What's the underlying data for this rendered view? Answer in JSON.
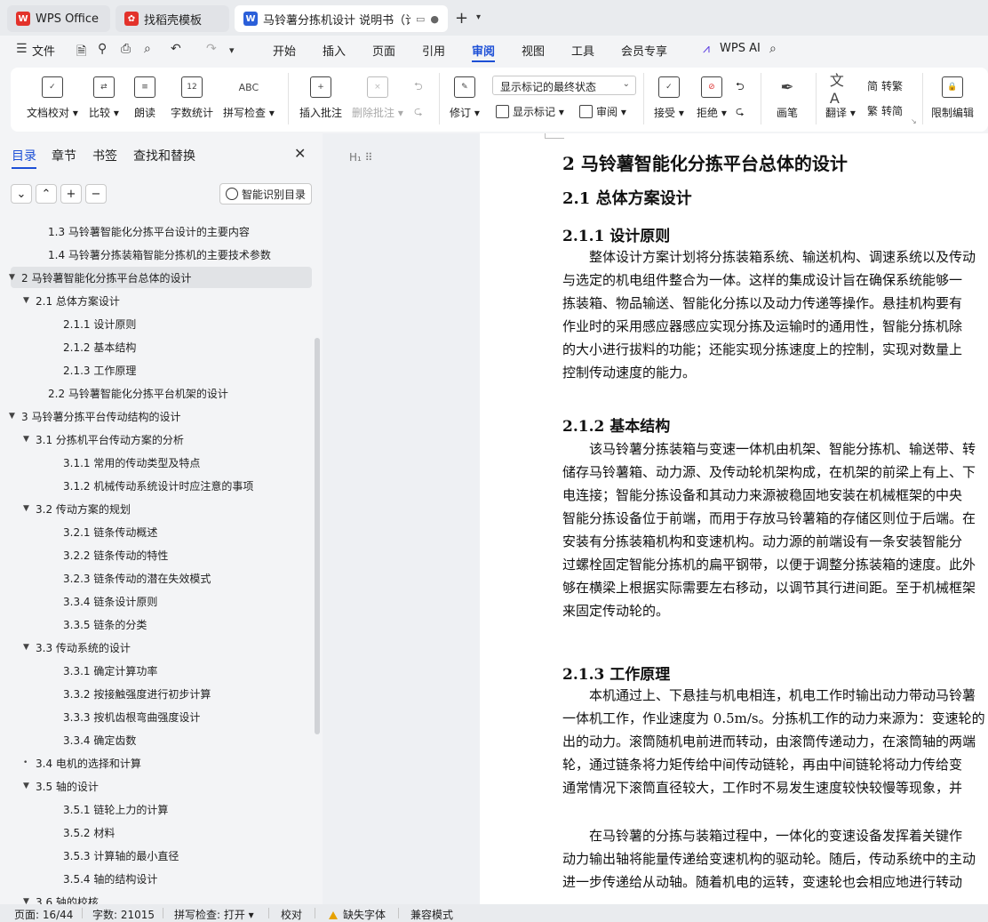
{
  "tabs": [
    {
      "label": "WPS Office",
      "icon": "wps-logo-icon",
      "color": "#e3322b"
    },
    {
      "label": "找稻壳模板",
      "icon": "docer-logo-icon",
      "color": "#e3322b"
    },
    {
      "label": "马铃薯分拣机设计 说明书（论",
      "icon": "writer-logo-icon",
      "color": "#2b5fd9"
    }
  ],
  "menu": {
    "file": "文件",
    "items": [
      "开始",
      "插入",
      "页面",
      "引用",
      "审阅",
      "视图",
      "工具",
      "会员专享"
    ],
    "active": "审阅",
    "ai": "WPS AI"
  },
  "ribbon": {
    "doc_check": "文档校对",
    "compare": "比较",
    "read": "朗读",
    "word_count": "字数统计",
    "spell_check": "拼写检查",
    "abc": "ABC",
    "insert_comment": "插入批注",
    "delete_comment": "删除批注",
    "revise": "修订",
    "markup_mode": "显示标记的最终状态",
    "show_markup": "显示标记",
    "review": "审阅",
    "accept": "接受",
    "reject": "拒绝",
    "ink": "画笔",
    "translate": "翻译",
    "to_traditional": "转繁",
    "to_simplified": "转简",
    "restrict": "限制编辑"
  },
  "sidebar": {
    "tabs": [
      "目录",
      "章节",
      "书签",
      "查找和替换"
    ],
    "smart_toc": "智能识别目录",
    "toc": [
      {
        "text": "1.3  马铃薯智能化分拣平台设计的主要内容",
        "level": 2,
        "caret": ""
      },
      {
        "text": "1.4  马铃薯分拣装箱智能分拣机的主要技术参数",
        "level": 2,
        "caret": ""
      },
      {
        "text": "2  马铃薯智能化分拣平台总体的设计",
        "level": 1,
        "caret": "▼",
        "selected": true
      },
      {
        "text": "2.1  总体方案设计",
        "level": 2,
        "caret": "▼"
      },
      {
        "text": "2.1.1  设计原则",
        "level": 3,
        "caret": ""
      },
      {
        "text": "2.1.2  基本结构",
        "level": 3,
        "caret": ""
      },
      {
        "text": "2.1.3  工作原理",
        "level": 3,
        "caret": ""
      },
      {
        "text": "2.2 马铃薯智能化分拣平台机架的设计",
        "level": 2,
        "caret": ""
      },
      {
        "text": "3  马铃薯分拣平台传动结构的设计",
        "level": 1,
        "caret": "▼"
      },
      {
        "text": "3.1 分拣机平台传动方案的分析",
        "level": 2,
        "caret": "▼"
      },
      {
        "text": "3.1.1 常用的传动类型及特点",
        "level": 3,
        "caret": ""
      },
      {
        "text": "3.1.2 机械传动系统设计时应注意的事项",
        "level": 3,
        "caret": ""
      },
      {
        "text": "3.2  传动方案的规划",
        "level": 2,
        "caret": "▼"
      },
      {
        "text": "3.2.1  链条传动概述",
        "level": 3,
        "caret": ""
      },
      {
        "text": "3.2.2  链条传动的特性",
        "level": 3,
        "caret": ""
      },
      {
        "text": "3.2.3  链条传动的潜在失效模式",
        "level": 3,
        "caret": ""
      },
      {
        "text": "3.3.4  链条设计原则",
        "level": 3,
        "caret": ""
      },
      {
        "text": "3.3.5  链条的分类",
        "level": 3,
        "caret": ""
      },
      {
        "text": "3.3 传动系统的设计",
        "level": 2,
        "caret": "▼"
      },
      {
        "text": "3.3.1 确定计算功率",
        "level": 3,
        "caret": ""
      },
      {
        "text": "3.3.2 按接触强度进行初步计算",
        "level": 3,
        "caret": ""
      },
      {
        "text": "3.3.3 按机齿根弯曲强度设计",
        "level": 3,
        "caret": ""
      },
      {
        "text": "3.3.4 确定齿数",
        "level": 3,
        "caret": ""
      },
      {
        "text": "3.4 电机的选择和计算",
        "level": 2,
        "caret": "•"
      },
      {
        "text": "3.5 轴的设计",
        "level": 2,
        "caret": "▼"
      },
      {
        "text": "3.5.1 链轮上力的计算",
        "level": 3,
        "caret": ""
      },
      {
        "text": "3.5.2 材料",
        "level": 3,
        "caret": ""
      },
      {
        "text": "3.5.3 计算轴的最小直径",
        "level": 3,
        "caret": ""
      },
      {
        "text": "3.5.4 轴的结构设计",
        "level": 3,
        "caret": ""
      },
      {
        "text": "3.6 轴的校核",
        "level": 2,
        "caret": "▼"
      }
    ]
  },
  "document": {
    "h1": "2  马铃薯智能化分拣平台总体的设计",
    "h2_1": "2.1  总体方案设计",
    "h3_1": "2.1.1  设计原则",
    "p1": [
      "整体设计方案计划将分拣装箱系统、输送机构、调速系统以及传动",
      "与选定的机电组件整合为一体。这样的集成设计旨在确保系统能够一",
      "拣装箱、物品输送、智能化分拣以及动力传递等操作。悬挂机构要有",
      "作业时的采用感应器感应实现分拣及运输时的通用性，智能分拣机除",
      "的大小进行拔料的功能；还能实现分拣速度上的控制，实现对数量上",
      "控制传动速度的能力。"
    ],
    "h3_2": "2.1.2  基本结构",
    "p2": [
      "该马铃薯分拣装箱与变速一体机由机架、智能分拣机、输送带、转",
      "储存马铃薯箱、动力源、及传动轮机架构成，在机架的前梁上有上、下",
      "电连接；智能分拣设备和其动力来源被稳固地安装在机械框架的中央",
      "智能分拣设备位于前端，而用于存放马铃薯箱的存储区则位于后端。在",
      "安装有分拣装箱机构和变速机构。动力源的前端设有一条安装智能分",
      "过螺栓固定智能分拣机的扁平钢带，以便于调整分拣装箱的速度。此外",
      "够在横梁上根据实际需要左右移动，以调节其行进间距。至于机械框架",
      "来固定传动轮的。"
    ],
    "h3_3": "2.1.3  工作原理",
    "p3": [
      "本机通过上、下悬挂与机电相连，机电工作时输出动力带动马铃薯",
      "一体机工作，作业速度为 0.5m/s。分拣机工作的动力来源为：变速轮的",
      "出的动力。滚筒随机电前进而转动，由滚筒传递动力，在滚筒轴的两端",
      "轮，通过链条将力矩传给中间传动链轮，再由中间链轮将动力传给变",
      "通常情况下滚筒直径较大，工作时不易发生速度较快较慢等现象，并"
    ],
    "p4": [
      "在马铃薯的分拣与装箱过程中，一体化的变速设备发挥着关键作",
      "动力输出轴将能量传递给变速机构的驱动轮。随后，传动系统中的主动",
      "进一步传递给从动轴。随着机电的运转，变速轮也会相应地进行转动"
    ]
  },
  "status": {
    "page": "页面: 16/44",
    "words": "字数: 21015",
    "spell": "拼写检查: 打开",
    "proof": "校对",
    "missing_font": "缺失字体",
    "compat": "兼容模式"
  }
}
